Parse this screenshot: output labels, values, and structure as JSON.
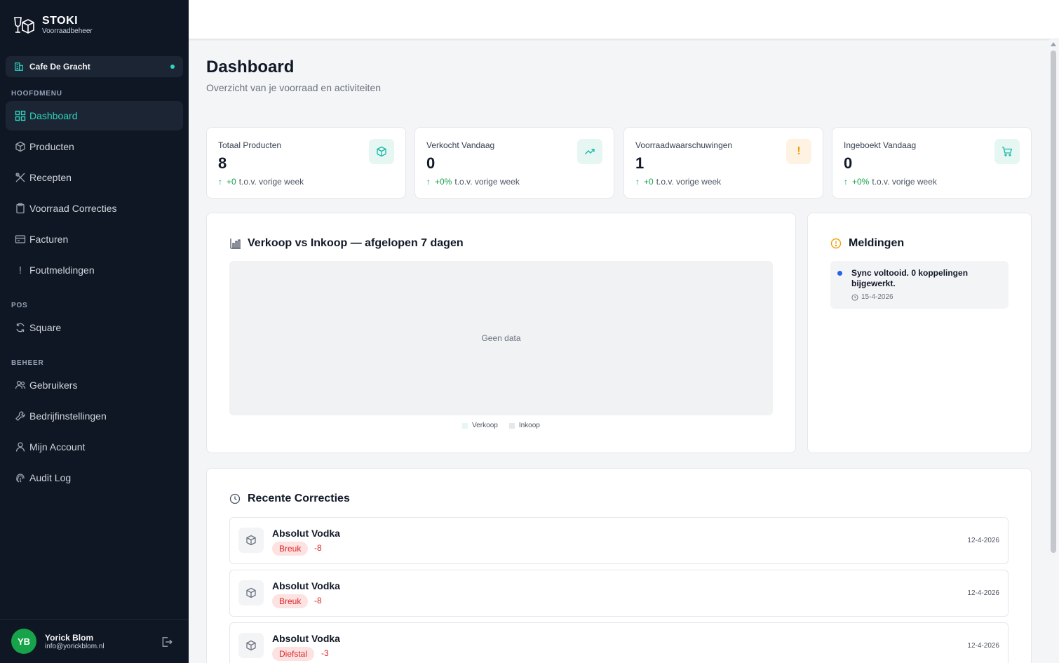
{
  "brand": {
    "name": "STOKI",
    "subtitle": "Voorraadbeheer"
  },
  "location": {
    "name": "Cafe De Gracht"
  },
  "sidebar": {
    "sections": {
      "main": "HOOFDMENU",
      "pos": "POS",
      "admin": "BEHEER"
    },
    "main_items": [
      {
        "label": "Dashboard",
        "icon": "grid-icon"
      },
      {
        "label": "Producten",
        "icon": "box-icon"
      },
      {
        "label": "Recepten",
        "icon": "utensils-icon"
      },
      {
        "label": "Voorraad Correcties",
        "icon": "clipboard-icon"
      },
      {
        "label": "Facturen",
        "icon": "credit-card-icon"
      },
      {
        "label": "Foutmeldingen",
        "icon": "exclamation-icon"
      }
    ],
    "pos_items": [
      {
        "label": "Square",
        "icon": "refresh-icon"
      }
    ],
    "admin_items": [
      {
        "label": "Gebruikers",
        "icon": "users-icon"
      },
      {
        "label": "Bedrijfinstellingen",
        "icon": "wrench-icon"
      },
      {
        "label": "Mijn Account",
        "icon": "user-icon"
      },
      {
        "label": "Audit Log",
        "icon": "fingerprint-icon"
      }
    ],
    "active_color": "#2dd4bf"
  },
  "user": {
    "initials": "YB",
    "name": "Yorick Blom",
    "email": "info@yorickblom.nl"
  },
  "page": {
    "title": "Dashboard",
    "subtitle": "Overzicht van je voorraad en activiteiten"
  },
  "stats": [
    {
      "title": "Totaal Producten",
      "value": "8",
      "delta": "+0",
      "suffix": "t.o.v. vorige week",
      "icon": "box-icon"
    },
    {
      "title": "Verkocht Vandaag",
      "value": "0",
      "delta": "+0%",
      "suffix": "t.o.v. vorige week",
      "icon": "trending-up-icon"
    },
    {
      "title": "Voorraadwaarschuwingen",
      "value": "1",
      "delta": "+0",
      "suffix": "t.o.v. vorige week",
      "icon": "exclamation-icon"
    },
    {
      "title": "Ingeboekt Vandaag",
      "value": "0",
      "delta": "+0%",
      "suffix": "t.o.v. vorige week",
      "icon": "cart-icon"
    }
  ],
  "chart": {
    "title": "Verkoop vs Inkoop — afgelopen 7 dagen",
    "empty_text": "Geen data",
    "legend": [
      {
        "label": "Verkoop",
        "color": "#e6f7f3"
      },
      {
        "label": "Inkoop",
        "color": "#e5e7eb"
      }
    ]
  },
  "notifications": {
    "title": "Meldingen",
    "items": [
      {
        "text": "Sync voltooid. 0 koppelingen bijgewerkt.",
        "date": "15-4-2026"
      }
    ]
  },
  "corrections": {
    "title": "Recente Correcties",
    "items": [
      {
        "product": "Absolut Vodka",
        "type": "Breuk",
        "qty": "-8",
        "date": "12-4-2026"
      },
      {
        "product": "Absolut Vodka",
        "type": "Breuk",
        "qty": "-8",
        "date": "12-4-2026"
      },
      {
        "product": "Absolut Vodka",
        "type": "Diefstal",
        "qty": "-3",
        "date": "12-4-2026"
      }
    ]
  }
}
